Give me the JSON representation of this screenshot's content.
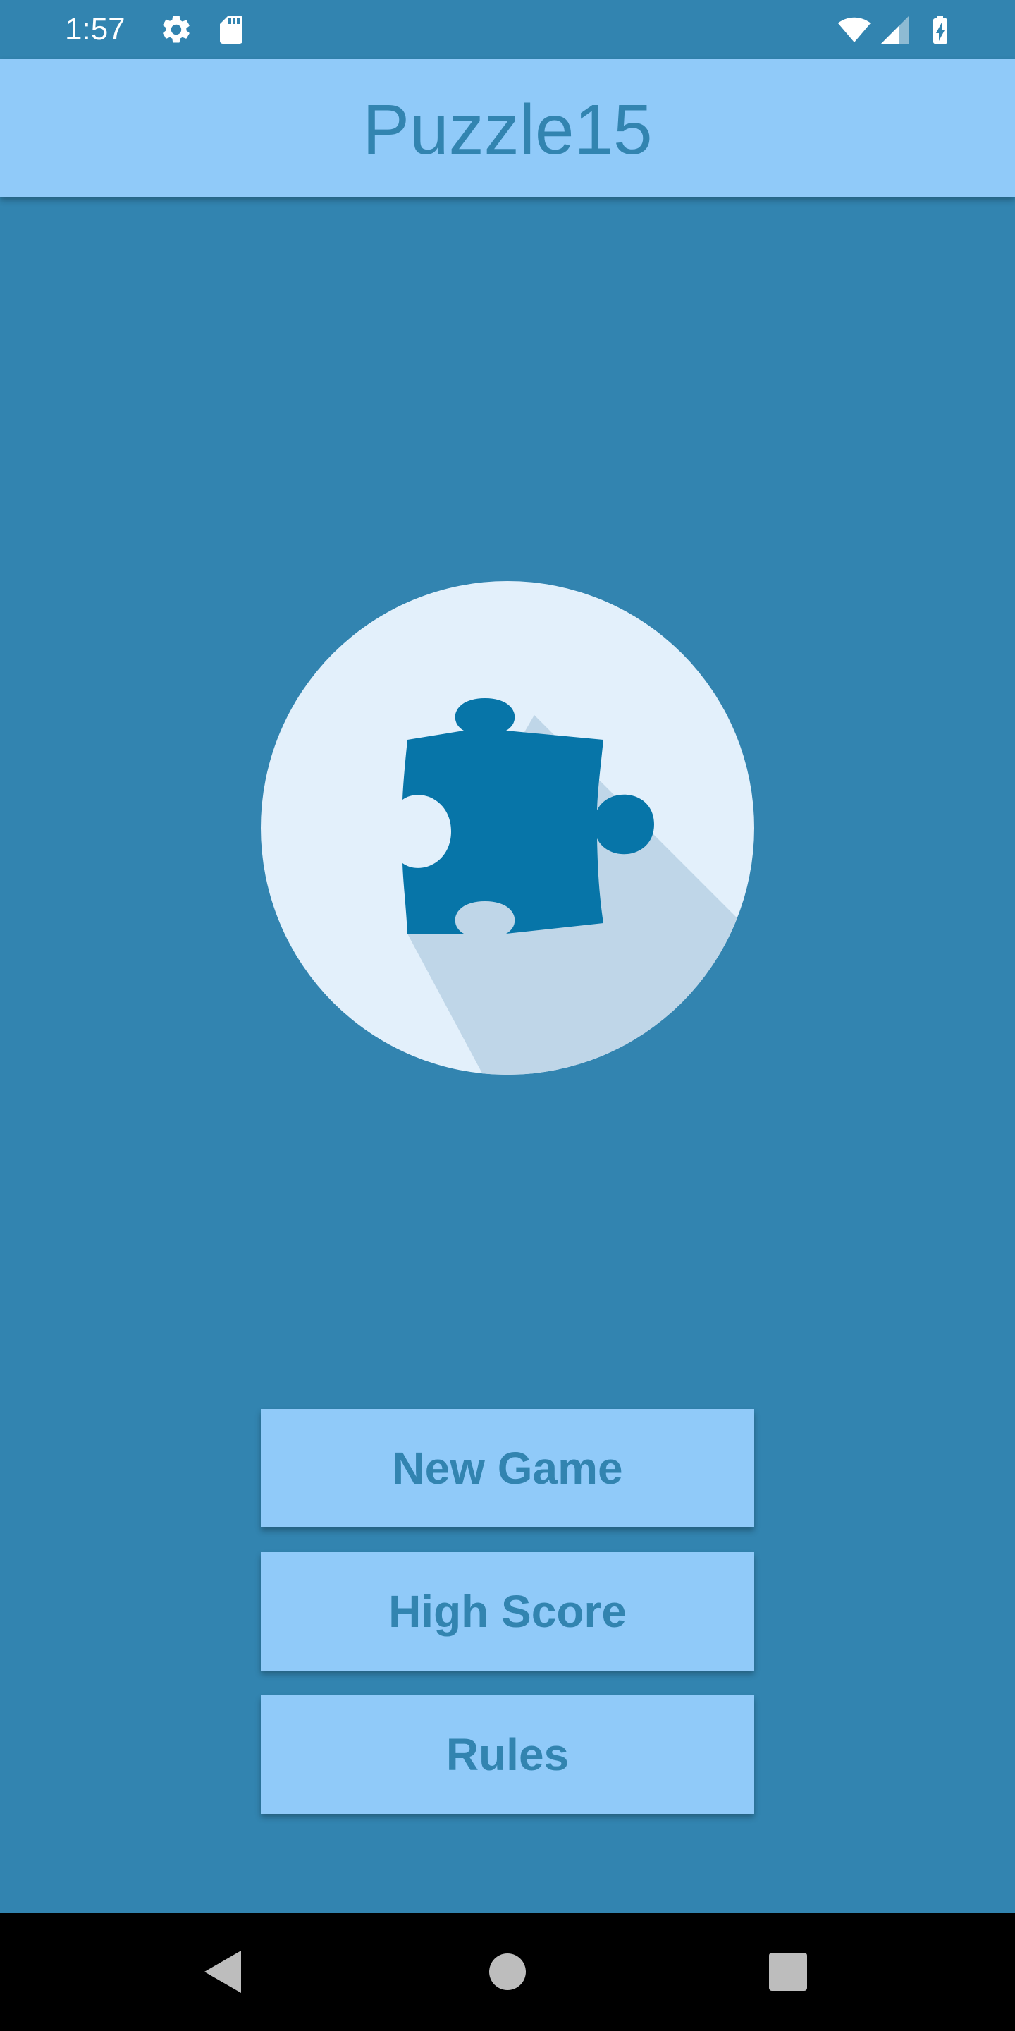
{
  "status_bar": {
    "time": "1:57",
    "icons": [
      "gear-icon",
      "sd-card-icon",
      "wifi-icon",
      "cell-signal-icon",
      "battery-charging-icon"
    ]
  },
  "app_bar": {
    "title": "Puzzle15"
  },
  "logo": {
    "icon": "puzzle-piece-icon",
    "colors": {
      "circle": "#e3f0fb",
      "shadow": "#bfd6e8",
      "piece": "#0775a8"
    }
  },
  "menu": {
    "new_game": "New Game",
    "high_score": "High Score",
    "rules": "Rules"
  },
  "nav_bar": {
    "icons": [
      "back-icon",
      "home-icon",
      "recents-icon"
    ]
  },
  "colors": {
    "background": "#3284b0",
    "app_bar": "#90caf9",
    "accent_text": "#3284b0",
    "nav_bar": "#000000"
  }
}
